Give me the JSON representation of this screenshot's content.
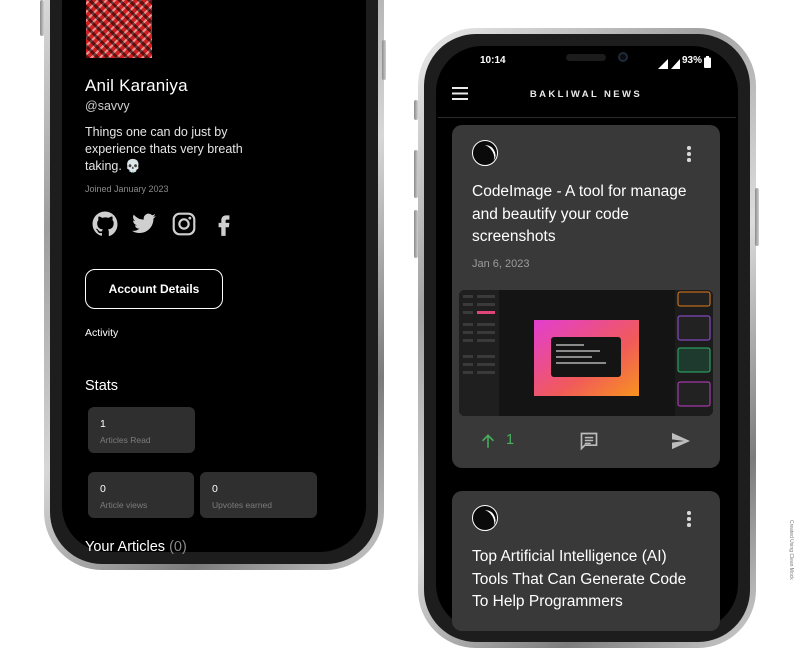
{
  "profile": {
    "name": "Anil Karaniya",
    "handle": "@savvy",
    "bio": "Things one can do just by experience thats very breath taking. 💀",
    "joined": "Joined January 2023",
    "social_icons": [
      "github-icon",
      "twitter-icon",
      "instagram-icon",
      "facebook-icon"
    ],
    "account_button_label": "Account Details",
    "activity_label": "Activity",
    "stats_title": "Stats",
    "stats": [
      {
        "value": "1",
        "label": "Articles Read"
      },
      {
        "value": "0",
        "label": "Article views"
      },
      {
        "value": "0",
        "label": "Upvotes earned"
      }
    ],
    "articles_title": "Your Articles",
    "articles_count": "(0)"
  },
  "status_bar": {
    "time": "10:14",
    "battery": "93%"
  },
  "app": {
    "title": "BAKLIWAL NEWS",
    "menu_icon": "hamburger-menu-icon"
  },
  "feed": [
    {
      "title": "CodeImage - A tool for manage and beautify your code screenshots",
      "date": "Jan 6, 2023",
      "upvotes": "1",
      "actions": [
        "upvote-arrow-icon",
        "comment-icon",
        "share-send-icon"
      ]
    },
    {
      "title": "Top Artificial Intelligence (AI) Tools That Can Generate Code To Help Programmers"
    }
  ],
  "colors": {
    "accent_green": "#49b05d",
    "card_bg": "#393939",
    "screen_bg": "#000000"
  },
  "watermark": "Created Using Clean Mock"
}
